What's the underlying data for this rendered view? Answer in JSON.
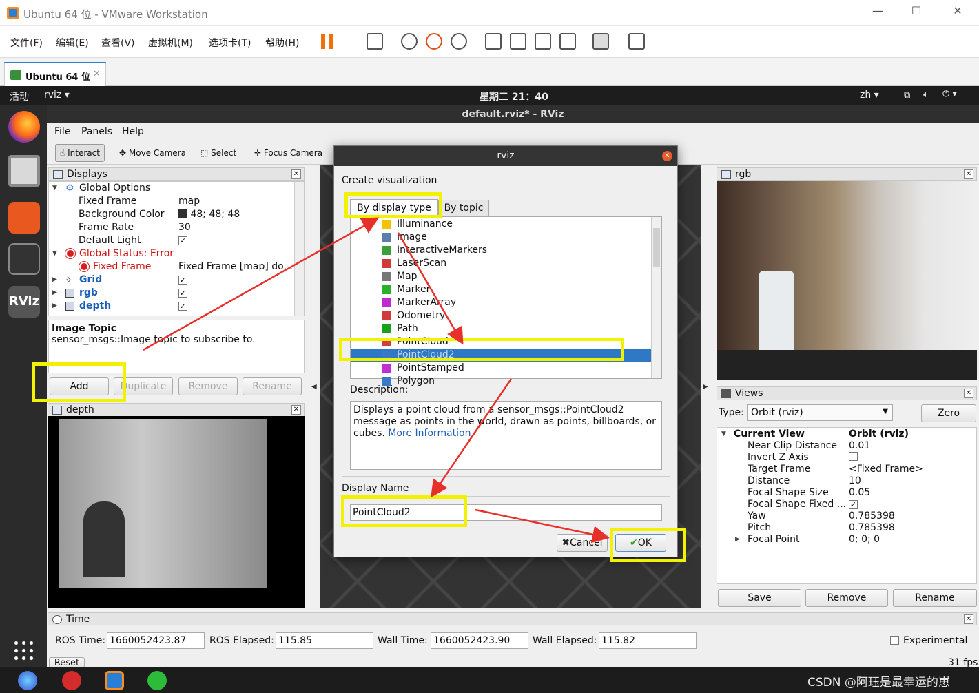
{
  "vmware": {
    "title": "Ubuntu 64 位 - VMware Workstation",
    "menu": [
      "文件(F)",
      "编辑(E)",
      "查看(V)",
      "虚拟机(M)",
      "选项卡(T)",
      "帮助(H)"
    ],
    "tab": "Ubuntu 64 位"
  },
  "ubuntu": {
    "activities": "活动",
    "app": "rviz ▾",
    "clock": "星期二 21：40",
    "lang": "zh ▾"
  },
  "rviz": {
    "window_title": "default.rviz* - RViz",
    "menu": [
      "File",
      "Panels",
      "Help"
    ],
    "tools": [
      "Interact",
      "Move Camera",
      "Select",
      "Focus Camera"
    ],
    "displays": {
      "title": "Displays",
      "rows": [
        {
          "k": "Global Options",
          "v": ""
        },
        {
          "k": "Fixed Frame",
          "v": "map"
        },
        {
          "k": "Background Color",
          "v": "48; 48; 48"
        },
        {
          "k": "Frame Rate",
          "v": "30"
        },
        {
          "k": "Default Light",
          "v": "✓"
        },
        {
          "k": "Global Status: Error",
          "v": ""
        },
        {
          "k": "Fixed Frame",
          "v": "Fixed Frame [map] do..."
        },
        {
          "k": "Grid",
          "v": "✓"
        },
        {
          "k": "rgb",
          "v": "✓"
        },
        {
          "k": "depth",
          "v": "✓"
        }
      ],
      "desc_title": "Image Topic",
      "desc_text": "sensor_msgs::Image topic to subscribe to.",
      "buttons": [
        "Add",
        "Duplicate",
        "Remove",
        "Rename"
      ]
    },
    "depth_title": "depth",
    "rgb_title": "rgb",
    "views": {
      "title": "Views",
      "type_label": "Type:",
      "type_value": "Orbit (rviz)",
      "zero": "Zero",
      "rows": [
        {
          "k": "Current View",
          "v": "Orbit (rviz)"
        },
        {
          "k": "Near Clip Distance",
          "v": "0.01"
        },
        {
          "k": "Invert Z Axis",
          "v": ""
        },
        {
          "k": "Target Frame",
          "v": "<Fixed Frame>"
        },
        {
          "k": "Distance",
          "v": "10"
        },
        {
          "k": "Focal Shape Size",
          "v": "0.05"
        },
        {
          "k": "Focal Shape Fixed ...",
          "v": "✓"
        },
        {
          "k": "Yaw",
          "v": "0.785398"
        },
        {
          "k": "Pitch",
          "v": "0.785398"
        },
        {
          "k": "Focal Point",
          "v": "0; 0; 0"
        }
      ],
      "buttons": [
        "Save",
        "Remove",
        "Rename"
      ]
    },
    "time": {
      "title": "Time",
      "ros_time_label": "ROS Time:",
      "ros_time": "1660052423.87",
      "ros_elapsed_label": "ROS Elapsed:",
      "ros_elapsed": "115.85",
      "wall_time_label": "Wall Time:",
      "wall_time": "1660052423.90",
      "wall_elapsed_label": "Wall Elapsed:",
      "wall_elapsed": "115.82",
      "experimental": "Experimental",
      "reset": "Reset",
      "fps": "31 fps"
    }
  },
  "dialog": {
    "title": "rviz",
    "heading": "Create visualization",
    "tabs": [
      "By display type",
      "By topic"
    ],
    "items": [
      "Illuminance",
      "Image",
      "InteractiveMarkers",
      "LaserScan",
      "Map",
      "Marker",
      "MarkerArray",
      "Odometry",
      "Path",
      "PointCloud",
      "PointCloud2",
      "PointStamped",
      "Polygon"
    ],
    "selected": "PointCloud2",
    "description_label": "Description:",
    "description": "Displays a point cloud from a sensor_msgs::PointCloud2 message as points in the world, drawn as points, billboards, or cubes.",
    "more_info": "More Information",
    "display_name_label": "Display Name",
    "display_name": "PointCloud2",
    "cancel": "Cancel",
    "ok": "OK"
  },
  "watermark": "CSDN @阿珏是最幸运的崽"
}
